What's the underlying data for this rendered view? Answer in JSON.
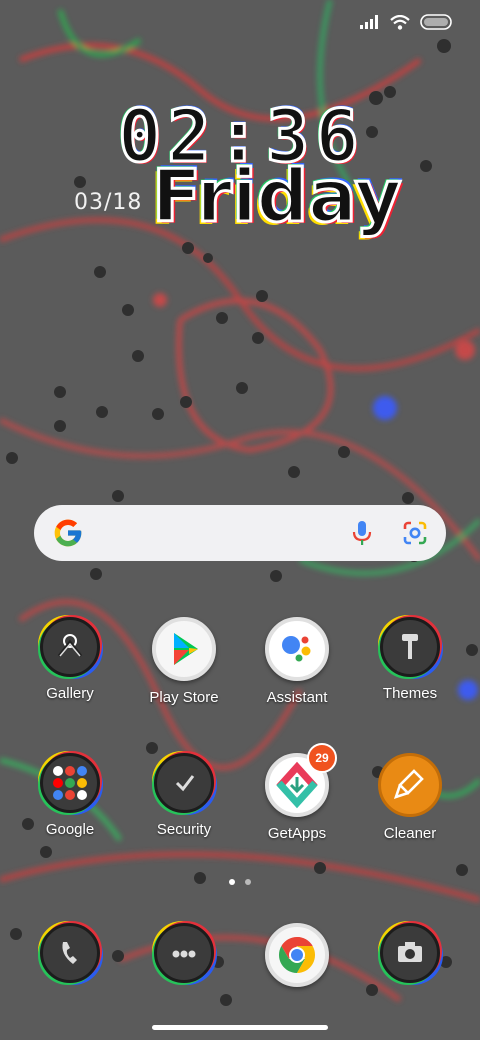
{
  "status_bar": {
    "signal_icon": "signal-bars-icon",
    "wifi_icon": "wifi-icon",
    "battery_icon": "battery-icon"
  },
  "clock_widget": {
    "time": "02:36",
    "date": "03/18",
    "day": "Friday"
  },
  "search_bar": {
    "logo": "G",
    "mic_icon": "mic-icon",
    "lens_icon": "lens-icon"
  },
  "apps_row1": [
    {
      "label": "Gallery",
      "icon": "gallery-icon"
    },
    {
      "label": "Play Store",
      "icon": "play-store-icon"
    },
    {
      "label": "Assistant",
      "icon": "assistant-icon"
    },
    {
      "label": "Themes",
      "icon": "themes-icon"
    }
  ],
  "apps_row2": [
    {
      "label": "Google",
      "icon": "google-folder-icon"
    },
    {
      "label": "Security",
      "icon": "security-icon"
    },
    {
      "label": "GetApps",
      "icon": "getapps-icon",
      "badge": "29"
    },
    {
      "label": "Cleaner",
      "icon": "cleaner-icon"
    }
  ],
  "dock": [
    {
      "icon": "phone-icon"
    },
    {
      "icon": "messaging-icon"
    },
    {
      "icon": "chrome-icon"
    },
    {
      "icon": "camera-icon"
    }
  ],
  "page_indicator": {
    "pages": 2,
    "active": 1
  },
  "colors": {
    "accent_red": "#e2313b",
    "accent_green": "#26c25a",
    "accent_blue": "#2a5cf0",
    "badge": "#f0521e"
  }
}
